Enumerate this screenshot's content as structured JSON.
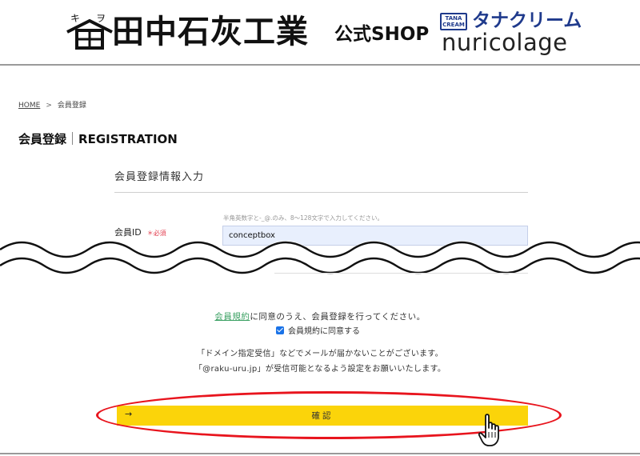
{
  "header": {
    "brand_name": "田中石灰工業",
    "brand_sub": "公式SHOP",
    "logo_glyphs": "キヲ",
    "tana_badge": "TANA CREAM",
    "tana_name": "タナクリーム",
    "nuricolage": "nuricolage"
  },
  "breadcrumb": {
    "home": "HOME",
    "separator": ">",
    "current": "会員登録"
  },
  "page_title": {
    "ja": "会員登録",
    "en": "REGISTRATION"
  },
  "form": {
    "section_heading": "会員登録情報入力",
    "id_hint": "半角英数字と-_@.のみ、8〜128文字で入力してください。",
    "id_label": "会員ID",
    "required_label": "＊必須",
    "id_value": "conceptbox"
  },
  "terms": {
    "link": "会員規約",
    "text": "に同意のうえ、会員登録を行ってください。",
    "agree_label": "会員規約に同意する",
    "agree_checked": true
  },
  "notice": {
    "line1": "「ドメイン指定受信」などでメールが届かないことがございます。",
    "line2": "「@raku-uru.jp」が受信可能となるよう設定をお願いいたします。"
  },
  "confirm": {
    "arrow": "→",
    "label": "確認"
  },
  "colors": {
    "accent_yellow": "#fbd40a",
    "highlight_red": "#e8141d",
    "link_green": "#3aa062",
    "required_red": "#e23b4c",
    "brand_blue": "#1f3a8c"
  }
}
